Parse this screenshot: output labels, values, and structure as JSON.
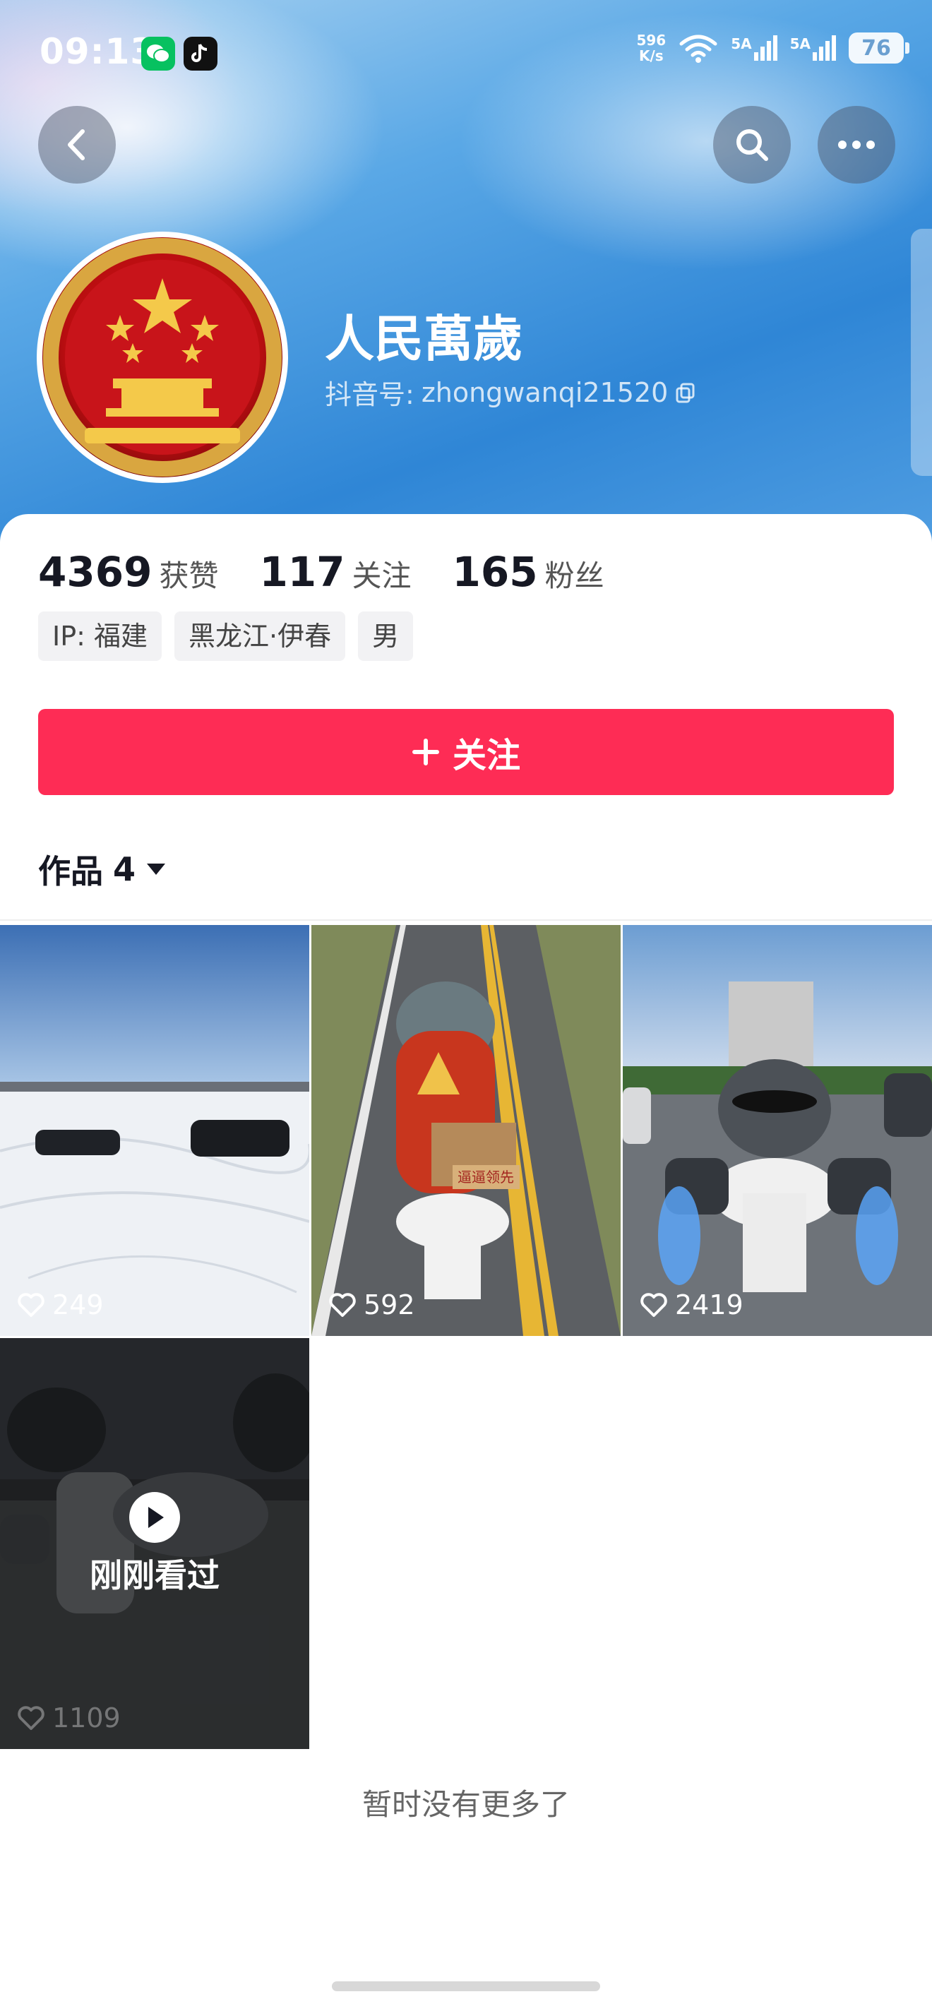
{
  "status_bar": {
    "time": "09:13",
    "net_speed_value": "596",
    "net_speed_unit": "K/s",
    "signal1_label": "5A",
    "signal2_label": "5A",
    "battery": "76"
  },
  "profile": {
    "name": "人民萬歲",
    "id_label": "抖音号:",
    "id_value": "zhongwanqi21520"
  },
  "stats": [
    {
      "value": "4369",
      "label": "获赞"
    },
    {
      "value": "117",
      "label": "关注"
    },
    {
      "value": "165",
      "label": "粉丝"
    }
  ],
  "tags": [
    "IP: 福建",
    "黑龙江·伊春",
    "男"
  ],
  "follow_button": {
    "label": "关注"
  },
  "works_tab": {
    "label": "作品",
    "count": "4"
  },
  "videos": [
    {
      "likes": "249"
    },
    {
      "likes": "592",
      "caption_on_image": "逼逼领先"
    },
    {
      "likes": "2419"
    },
    {
      "likes": "1109",
      "overlay_text": "刚刚看过"
    }
  ],
  "footer": {
    "no_more": "暂时没有更多了"
  },
  "colors": {
    "accent": "#fe2c55",
    "banner_blue": "#2f86d6"
  }
}
